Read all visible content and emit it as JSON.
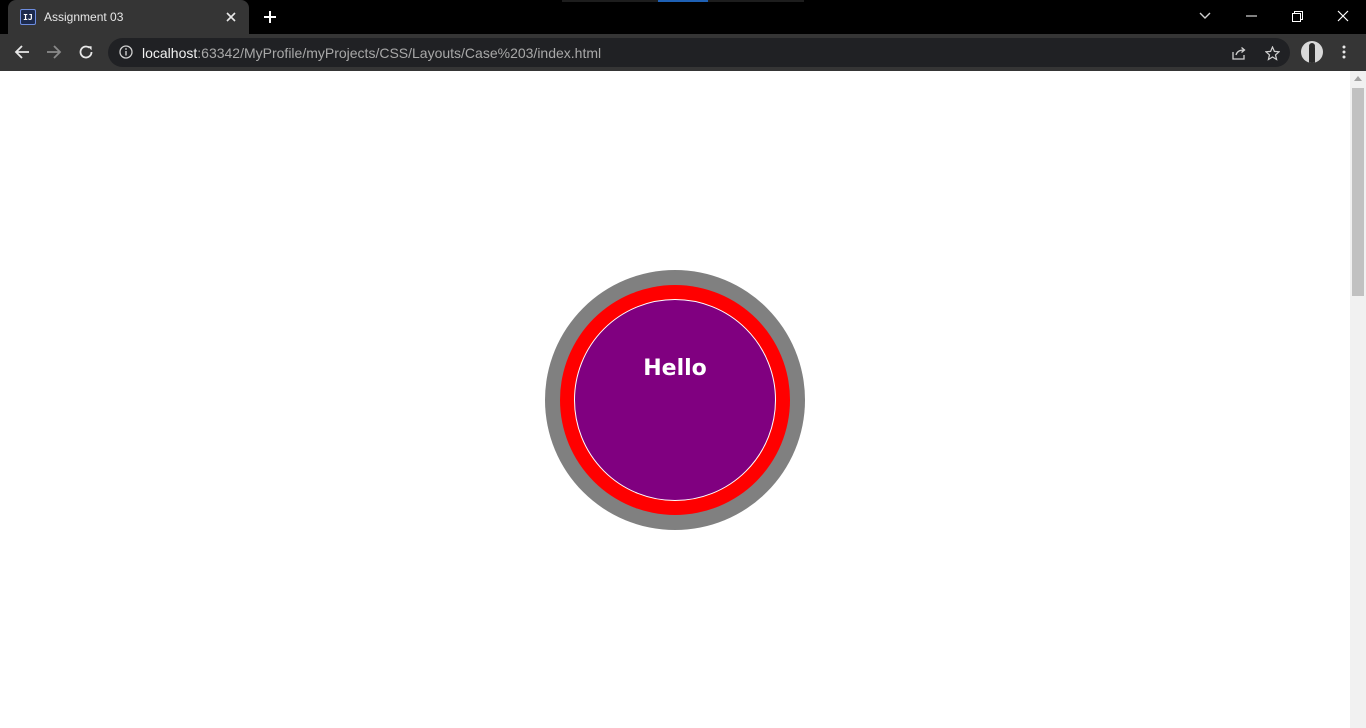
{
  "tab": {
    "title": "Assignment 03",
    "favicon_text": "IJ"
  },
  "toolbar": {
    "url_host": "localhost",
    "url_path": ":63342/MyProfile/myProjects/CSS/Layouts/Case%203/index.html"
  },
  "page": {
    "heading": "Hello"
  },
  "icons": {
    "back": "back-arrow-icon",
    "forward": "forward-arrow-icon",
    "reload": "reload-icon",
    "info": "info-icon",
    "share": "share-icon",
    "bookmark": "star-icon",
    "menu": "kebab-menu-icon",
    "new_tab": "plus-icon",
    "close_tab": "close-icon",
    "tab_search": "chevron-down-icon",
    "minimize": "minimize-icon",
    "restore": "restore-icon",
    "close_window": "close-icon"
  },
  "colors": {
    "outer_ring": "#808080",
    "middle_ring": "#ff0000",
    "inner_circle": "#800080",
    "text": "#ffffff"
  }
}
